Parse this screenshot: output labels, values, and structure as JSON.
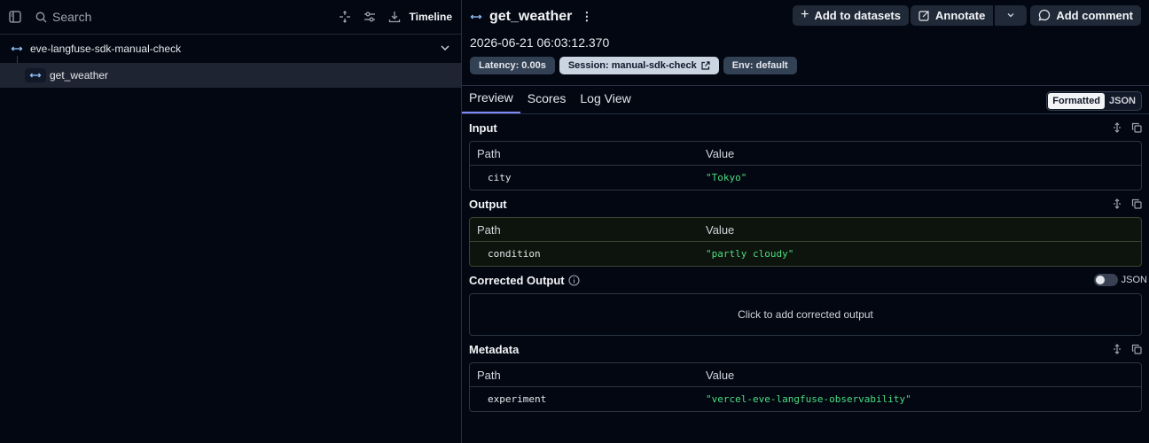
{
  "sidebar": {
    "search_label": "Search",
    "timeline_label": "Timeline",
    "trace": {
      "root_name": "eve-langfuse-sdk-manual-check",
      "child_name": "get_weather"
    }
  },
  "detail": {
    "title": "get_weather",
    "actions": {
      "add_to_datasets": "Add to datasets",
      "annotate": "Annotate",
      "add_comment": "Add comment"
    },
    "datetime": "2026-06-21 06:03:12.370",
    "pills": {
      "latency": "Latency: 0.00s",
      "session": "Session: manual-sdk-check",
      "env": "Env: default"
    },
    "tabs": [
      "Preview",
      "Scores",
      "Log View"
    ],
    "view_toggle": {
      "formatted": "Formatted",
      "json": "JSON"
    },
    "input": {
      "title": "Input",
      "headers": [
        "Path",
        "Value"
      ],
      "rows": [
        {
          "path": "city",
          "value": "\"Tokyo\""
        }
      ]
    },
    "output": {
      "title": "Output",
      "headers": [
        "Path",
        "Value"
      ],
      "rows": [
        {
          "path": "condition",
          "value": "\"partly cloudy\""
        }
      ]
    },
    "corrected": {
      "title": "Corrected Output",
      "json_label": "JSON",
      "placeholder": "Click to add corrected output"
    },
    "metadata": {
      "title": "Metadata",
      "headers": [
        "Path",
        "Value"
      ],
      "rows": [
        {
          "path": "experiment",
          "value": "\"vercel-eve-langfuse-observability\""
        }
      ]
    }
  },
  "colors": {
    "accent": "#818cf8",
    "value_green": "#4ade80",
    "bg": "#030712"
  }
}
